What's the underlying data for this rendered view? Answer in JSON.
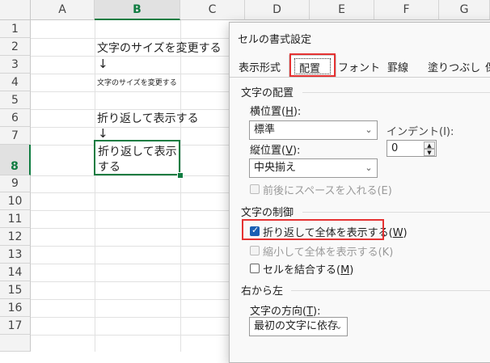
{
  "sheet": {
    "columns": [
      "A",
      "B",
      "C",
      "D",
      "E",
      "F",
      "G"
    ],
    "rows": [
      "1",
      "2",
      "3",
      "4",
      "5",
      "6",
      "7",
      "8",
      "9",
      "10",
      "11",
      "12",
      "13",
      "14",
      "15",
      "16",
      "17"
    ],
    "cells": {
      "b2": "文字のサイズを変更する",
      "b3": "↓",
      "b4": "文字のサイズを変更する",
      "b6": "折り返して表示する",
      "b7": "↓",
      "b8_line1": "折り返して表示",
      "b8_line2": "する"
    },
    "selected_column": "B",
    "selected_row": "8",
    "accent_color": "#107c41"
  },
  "dialog": {
    "title": "セルの書式設定",
    "tabs": [
      "表示形式",
      "配置",
      "フォント",
      "罫線",
      "塗りつぶし",
      "保"
    ],
    "active_tab": "配置",
    "text_alignment": {
      "section": "文字の配置",
      "horizontal_label": "横位置(",
      "horizontal_key": "H",
      "horizontal_value": "標準",
      "indent_label": "インデント(I):",
      "indent_value": "0",
      "vertical_label": "縦位置(",
      "vertical_key": "V",
      "vertical_value": "中央揃え",
      "justify_distributed": "前後にスペースを入れる(E)"
    },
    "text_control": {
      "section": "文字の制御",
      "wrap_text": "折り返して全体を表示する(",
      "wrap_key": "W",
      "wrap_checked": true,
      "shrink_to_fit": "縮小して全体を表示する(K)",
      "merge_cells": "セルを結合する(",
      "merge_key": "M"
    },
    "rtl": {
      "section": "右から左",
      "direction_label": "文字の方向(",
      "direction_key": "T",
      "direction_value": "最初の文字に依存"
    },
    "highlight_color": "#e53232",
    "checkbox_color": "#1a5fb4"
  }
}
